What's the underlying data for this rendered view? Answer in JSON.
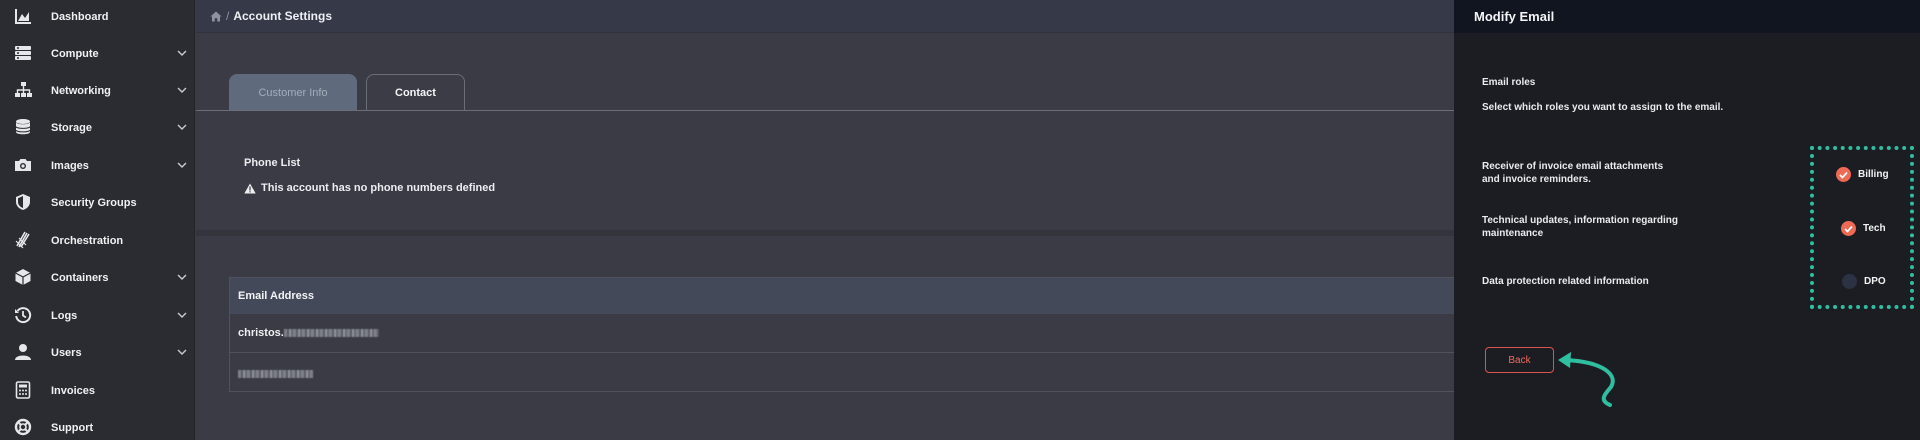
{
  "sidebar": {
    "items": [
      {
        "label": "Dashboard",
        "icon": "chart-area-icon",
        "has_submenu": false
      },
      {
        "label": "Compute",
        "icon": "server-icon",
        "has_submenu": true
      },
      {
        "label": "Networking",
        "icon": "network-icon",
        "has_submenu": true
      },
      {
        "label": "Storage",
        "icon": "database-icon",
        "has_submenu": true
      },
      {
        "label": "Images",
        "icon": "camera-icon",
        "has_submenu": true
      },
      {
        "label": "Security Groups",
        "icon": "shield-icon",
        "has_submenu": false
      },
      {
        "label": "Orchestration",
        "icon": "orchestration-icon",
        "has_submenu": false
      },
      {
        "label": "Containers",
        "icon": "cube-icon",
        "has_submenu": true
      },
      {
        "label": "Logs",
        "icon": "history-icon",
        "has_submenu": true
      },
      {
        "label": "Users",
        "icon": "user-icon",
        "has_submenu": true
      },
      {
        "label": "Invoices",
        "icon": "calculator-icon",
        "has_submenu": false
      },
      {
        "label": "Support",
        "icon": "lifebuoy-icon",
        "has_submenu": false
      }
    ]
  },
  "header": {
    "home_icon": "home-icon",
    "separator": "/",
    "title": "Account Settings"
  },
  "tabs": [
    {
      "label": "Customer Info",
      "active": false
    },
    {
      "label": "Contact",
      "active": true
    }
  ],
  "phone": {
    "title": "Phone List",
    "warning": "This account has no phone numbers defined"
  },
  "emails": {
    "header": "Email Address",
    "rows": [
      {
        "visible_text": "christos."
      },
      {
        "visible_text": ""
      }
    ]
  },
  "panel": {
    "title": "Modify Email",
    "roles_title": "Email roles",
    "roles_subtitle": "Select which roles you want to assign to the email.",
    "roles": [
      {
        "desc_line1": "Receiver of invoice email attachments",
        "desc_line2": "and invoice reminders.",
        "label": "Billing",
        "checked": true
      },
      {
        "desc_line1": "Technical updates, information regarding",
        "desc_line2": "maintenance",
        "label": "Tech",
        "checked": true
      },
      {
        "desc_line1": "Data protection related information",
        "desc_line2": "",
        "label": "DPO",
        "checked": false
      }
    ],
    "back_label": "Back"
  },
  "colors": {
    "accent": "#ef6a55",
    "highlight": "#2fbfa0",
    "sidebar_bg": "#2b2c31",
    "panel_bg": "#1c1d22"
  }
}
